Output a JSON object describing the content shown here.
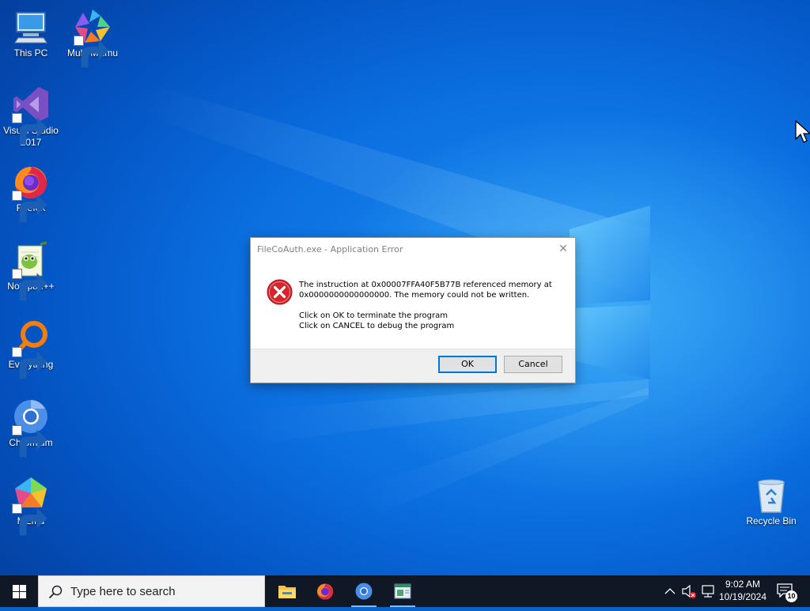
{
  "desktop": {
    "icons_left": [
      {
        "label": "This PC",
        "icon": "this-pc-icon"
      },
      {
        "label": "Multi-MEmu",
        "icon": "multi-memu-icon"
      },
      {
        "label": "Visual Studio 2017",
        "icon": "visual-studio-icon"
      },
      {
        "label": "Firefox",
        "icon": "firefox-icon"
      },
      {
        "label": "Notepad++",
        "icon": "notepadpp-icon"
      },
      {
        "label": "Everything",
        "icon": "everything-icon"
      },
      {
        "label": "Chromium",
        "icon": "chromium-icon"
      },
      {
        "label": "MEmu",
        "icon": "memu-icon"
      }
    ],
    "recycle_bin": {
      "label": "Recycle Bin",
      "icon": "recycle-bin-icon"
    }
  },
  "dialog": {
    "title": "FileCoAuth.exe - Application Error",
    "close_glyph": "✕",
    "line1": "The instruction at 0x00007FFA40F5B77B referenced memory at",
    "line2": "0x0000000000000000. The memory could not be written.",
    "line3": "Click on OK to terminate the program",
    "line4": "Click on CANCEL to debug the program",
    "ok_label": "OK",
    "cancel_label": "Cancel"
  },
  "taskbar": {
    "search_placeholder": "Type here to search",
    "pinned_apps": [
      "file-explorer-icon",
      "firefox-icon",
      "chromium-icon",
      "app-icon"
    ],
    "time": "9:02 AM",
    "date": "10/19/2024",
    "notification_count": "10"
  },
  "colors": {
    "accent": "#0078d7",
    "taskbar": "#101826",
    "error_red": "#d9242b"
  }
}
